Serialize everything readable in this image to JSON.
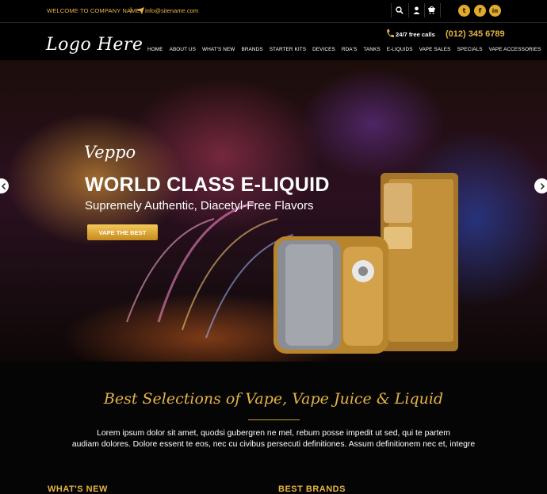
{
  "topbar": {
    "welcome": "WELCOME TO COMPANY NAME",
    "separator": "|",
    "email": "info@sitename.com",
    "icons": [
      "search-icon",
      "user-icon",
      "cart-icon"
    ],
    "social": [
      {
        "name": "twitter-icon",
        "glyph": "t"
      },
      {
        "name": "facebook-icon",
        "glyph": "f"
      },
      {
        "name": "linkedin-icon",
        "glyph": "in"
      }
    ]
  },
  "header": {
    "logo": "Logo Here",
    "calls_label": "24/7 free calls",
    "phone": "(012) 345 6789"
  },
  "nav": [
    "HOME",
    "ABOUT US",
    "WHAT'S NEW",
    "BRANDS",
    "STARTER KITS",
    "DEVICES",
    "RDA'S",
    "TANKS",
    "E-LIQUIDS",
    "VAPE SALES",
    "SPECIALS",
    "VAPE ACCESSORIES"
  ],
  "hero": {
    "brand_script": "Veppo",
    "title": "WORLD CLASS E-LIQUID",
    "subtitle": "Supremely Authentic, Diacetyl-Free Flavors",
    "button": "VAPE THE BEST"
  },
  "section": {
    "title": "Best Selections of Vape, Vape Juice & Liquid",
    "text_line1": "Lorem ipsum dolor sit amet, quodsi gubergren ne mel, rebum posse impedit ut sed, qui te partem",
    "text_line2": "audiam dolores. Dolore essent te eos, nec cu civibus persecuti definitiones. Assum definitionem nec et, integre"
  },
  "columns": {
    "left": "WHAT'S NEW",
    "right": "BEST BRANDS"
  },
  "colors": {
    "accent": "#e6b446",
    "background": "#050505"
  }
}
